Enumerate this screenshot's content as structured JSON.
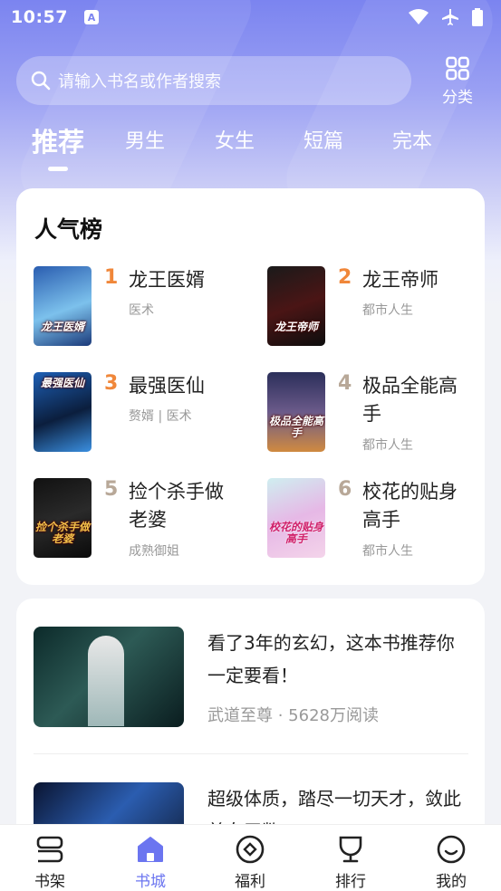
{
  "status_bar": {
    "time": "10:57",
    "notification_badge": "A"
  },
  "search": {
    "placeholder": "请输入书名或作者搜索"
  },
  "category_button": {
    "label": "分类",
    "icon": "grid-icon"
  },
  "tabs": [
    {
      "label": "推荐",
      "active": true
    },
    {
      "label": "男生",
      "active": false
    },
    {
      "label": "女生",
      "active": false
    },
    {
      "label": "短篇",
      "active": false
    },
    {
      "label": "完本",
      "active": false
    }
  ],
  "ranking": {
    "title": "人气榜",
    "books": [
      {
        "rank": "1",
        "title": "龙王医婿",
        "tag": "医术",
        "cover_text": "龙王医婿",
        "rank_color": "#f0873a"
      },
      {
        "rank": "2",
        "title": "龙王帝师",
        "tag": "都市人生",
        "cover_text": "龙王帝师",
        "rank_color": "#f0873a"
      },
      {
        "rank": "3",
        "title": "最强医仙",
        "tag": "赘婿 | 医术",
        "cover_text": "最强医仙",
        "rank_color": "#f0873a"
      },
      {
        "rank": "4",
        "title": "极品全能高手",
        "tag": "都市人生",
        "cover_text": "极品全能高手",
        "rank_color": "#b8a898"
      },
      {
        "rank": "5",
        "title": "捡个杀手做老婆",
        "tag": "成熟御姐",
        "cover_text": "捡个杀手做老婆",
        "rank_color": "#b8a898"
      },
      {
        "rank": "6",
        "title": "校花的贴身高手",
        "tag": "都市人生",
        "cover_text": "校花的贴身高手",
        "rank_color": "#b8a898"
      }
    ]
  },
  "articles": [
    {
      "title": "看了3年的玄幻，这本书推荐你一定要看！",
      "meta": "武道至尊 · 5628万阅读"
    },
    {
      "title": "超级体质，踏尽一切天才，敛此美女无数！",
      "meta": ""
    }
  ],
  "bottom_nav": [
    {
      "label": "书架",
      "icon": "bookshelf-icon",
      "active": false
    },
    {
      "label": "书城",
      "icon": "home-icon",
      "active": true
    },
    {
      "label": "福利",
      "icon": "coin-icon",
      "active": false
    },
    {
      "label": "排行",
      "icon": "trophy-icon",
      "active": false
    },
    {
      "label": "我的",
      "icon": "smile-icon",
      "active": false
    }
  ],
  "colors": {
    "accent": "#6b75f0",
    "hero_top": "#7b84f0",
    "rank_top": "#f0873a",
    "rank_other": "#b8a898"
  }
}
